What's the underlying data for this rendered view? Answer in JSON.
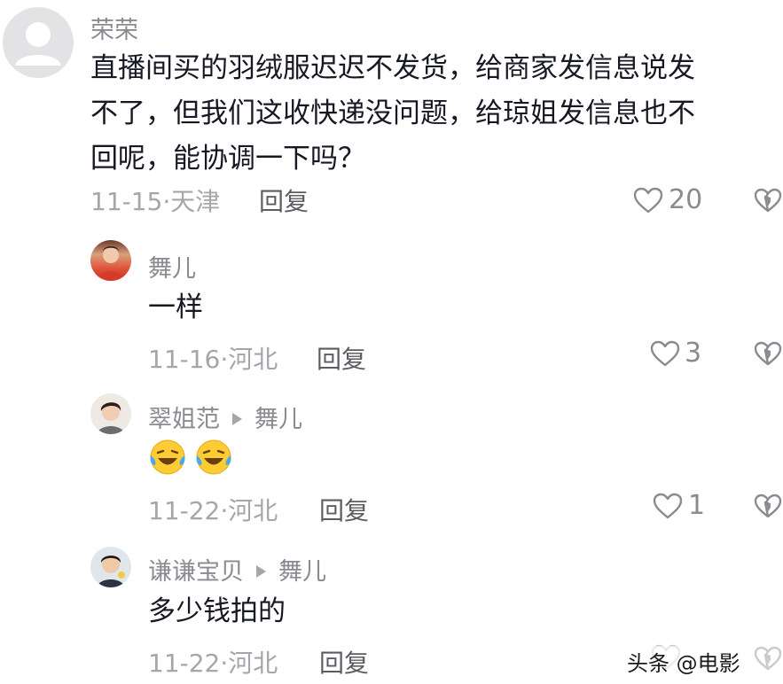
{
  "comments": [
    {
      "user": "荣荣",
      "text_lines": [
        "直播间买的羽绒服迟迟不发货，给商家发信息说发",
        "不了，但我们这收快递没问题，给琼姐发信息也不",
        "回呢，能协调一下吗？"
      ],
      "date_location": "11-15·天津",
      "reply_label": "回复",
      "likes": "20"
    },
    {
      "user": "舞儿",
      "text": "一样",
      "date_location": "11-16·河北",
      "reply_label": "回复",
      "likes": "3"
    },
    {
      "user": "翠姐范",
      "reply_to": "舞儿",
      "emoji": [
        "laughing-tears-emoji",
        "laughing-tears-emoji"
      ],
      "date_location": "11-22·河北",
      "reply_label": "回复",
      "likes": "1"
    },
    {
      "user": "谦谦宝贝",
      "reply_to": "舞儿",
      "text": "多少钱拍的",
      "date_location": "11-22·河北",
      "reply_label": "回复",
      "likes": ""
    }
  ],
  "icons": {
    "like": "heart-outline-icon",
    "dislike": "broken-heart-icon",
    "reply_arrow": "triangle-right-icon"
  },
  "watermark": "头条 @电影"
}
